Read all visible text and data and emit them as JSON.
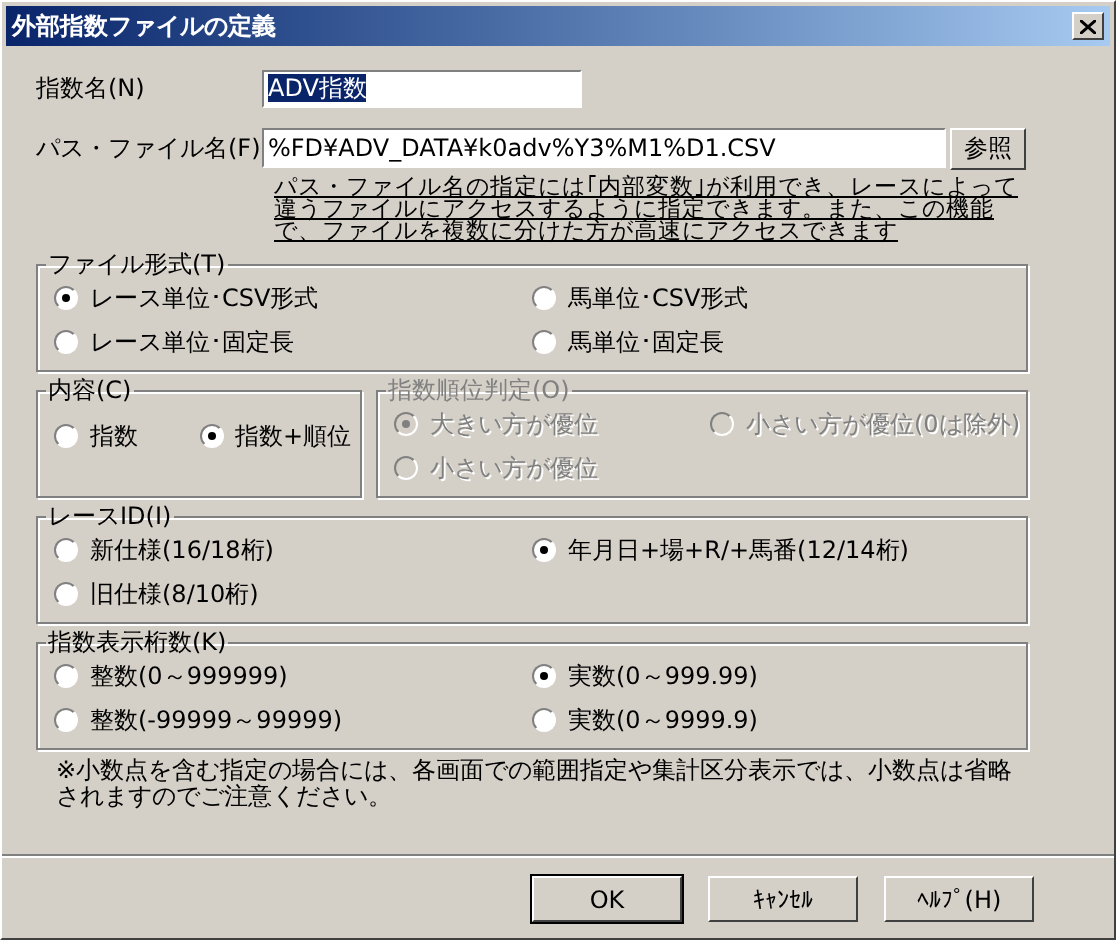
{
  "window": {
    "title": "外部指数ファイルの定義"
  },
  "name_field": {
    "label": "指数名(N)",
    "value": "ADV指数"
  },
  "path_field": {
    "label": "パス・ファイル名(F)",
    "value": "%FD¥ADV_DATA¥k0adv%Y3%M1%D1.CSV",
    "browse_button": "参照",
    "note": "パス・ファイル名の指定には｢内部変数｣が利用でき、レースによって違うファイルにアクセスするように指定できます。また、この機能で、ファイルを複数に分けた方が高速にアクセスできます"
  },
  "file_format": {
    "title": "ファイル形式(T)",
    "options": [
      {
        "label": "レース単位･CSV形式",
        "selected": true
      },
      {
        "label": "馬単位･CSV形式",
        "selected": false
      },
      {
        "label": "レース単位･固定長",
        "selected": false
      },
      {
        "label": "馬単位･固定長",
        "selected": false
      }
    ]
  },
  "content": {
    "title": "内容(C)",
    "options": [
      {
        "label": "指数",
        "selected": false
      },
      {
        "label": "指数+順位",
        "selected": true
      }
    ]
  },
  "rank_judgement": {
    "title": "指数順位判定(O)",
    "disabled": true,
    "options": [
      {
        "label": "大きい方が優位",
        "selected": true
      },
      {
        "label": "小さい方が優位(0は除外)",
        "selected": false
      },
      {
        "label": "小さい方が優位",
        "selected": false
      }
    ]
  },
  "race_id": {
    "title": "レースID(I)",
    "options": [
      {
        "label": "新仕様(16/18桁)",
        "selected": false
      },
      {
        "label": "年月日+場+R/+馬番(12/14桁)",
        "selected": true
      },
      {
        "label": "旧仕様(8/10桁)",
        "selected": false
      }
    ]
  },
  "digits": {
    "title": "指数表示桁数(K)",
    "options": [
      {
        "label": "整数(0～999999)",
        "selected": false
      },
      {
        "label": "実数(0～999.99)",
        "selected": true
      },
      {
        "label": "整数(-99999～99999)",
        "selected": false
      },
      {
        "label": "実数(0～9999.9)",
        "selected": false
      }
    ]
  },
  "footnote": "※小数点を含む指定の場合には、各画面での範囲指定や集計区分表示では、小数点は省略されますのでご注意ください。",
  "buttons": [
    {
      "label": "OK",
      "default": true
    },
    {
      "label": "ｷｬﾝｾﾙ",
      "default": false
    },
    {
      "label": "ﾍﾙﾌﾟ(H)",
      "default": false
    }
  ]
}
